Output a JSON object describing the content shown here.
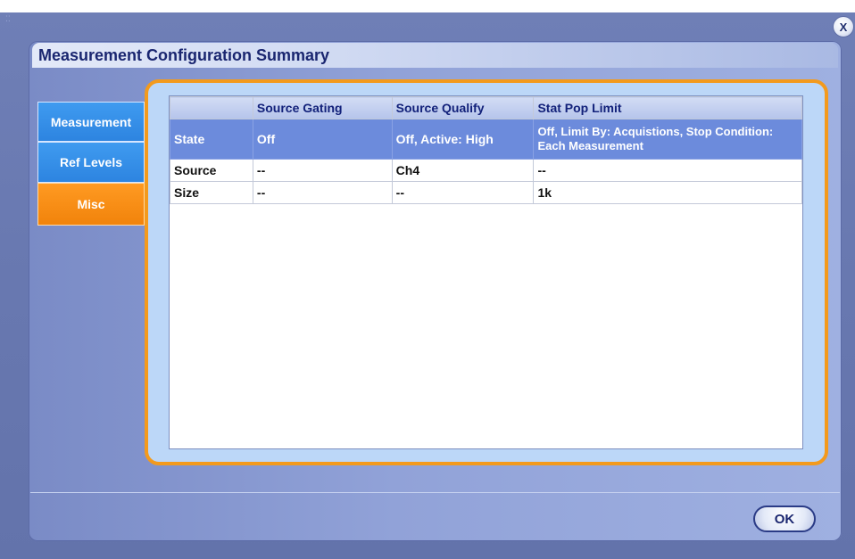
{
  "window": {
    "title": "Measurement Configuration Summary",
    "close_label": "X",
    "ok_label": "OK"
  },
  "tabs": [
    {
      "label": "Measurement",
      "active": false
    },
    {
      "label": "Ref Levels",
      "active": false
    },
    {
      "label": "Misc",
      "active": true
    }
  ],
  "table": {
    "columns": [
      "",
      "Source Gating",
      "Source Qualify",
      "Stat Pop Limit"
    ],
    "rows": [
      {
        "label": "State",
        "cells": [
          "Off",
          "Off, Active: High",
          "Off, Limit By: Acquistions, Stop Condition: Each Measurement"
        ]
      },
      {
        "label": "Source",
        "cells": [
          "--",
          "Ch4",
          "--"
        ]
      },
      {
        "label": "Size",
        "cells": [
          "--",
          "--",
          "1k"
        ]
      }
    ]
  },
  "colors": {
    "tab_active": "#f1830b",
    "tab_inactive": "#2d84e0",
    "frame_border": "#f39a1d",
    "highlight_row": "#6c8bdc"
  }
}
